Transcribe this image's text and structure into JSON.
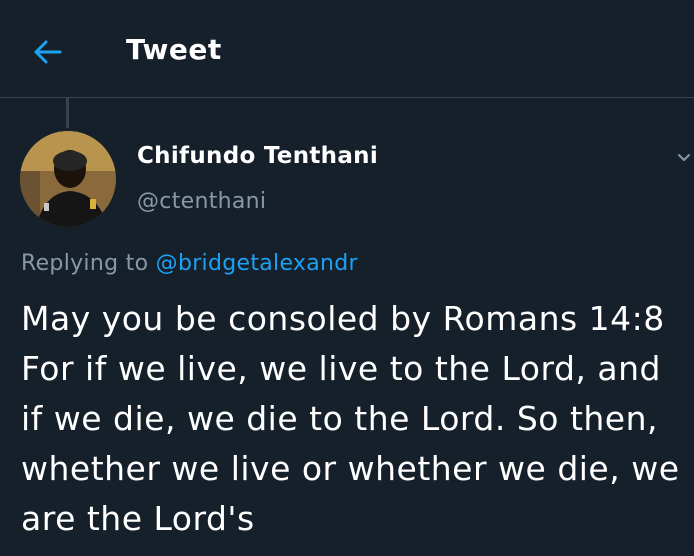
{
  "header": {
    "title": "Tweet",
    "back_icon": "arrow-left-icon",
    "accent": "#1da1f2"
  },
  "tweet": {
    "author": {
      "display_name": "Chifundo Tenthani",
      "handle": "@ctenthani",
      "avatar": "avatar-photo"
    },
    "replying_prefix": "Replying to",
    "replying_to": "@bridgetalexandr",
    "text": "May you be consoled by Romans 14:8 For if we live, we live to the Lord, and if we die, we die to the Lord. So then, whether we live or whether we die, we are the Lord's",
    "more_icon": "chevron-down-icon"
  },
  "colors": {
    "background": "#15202b",
    "text": "#ffffff",
    "secondary_text": "#8899a6",
    "divider": "#38444d",
    "link": "#1da1f2"
  }
}
